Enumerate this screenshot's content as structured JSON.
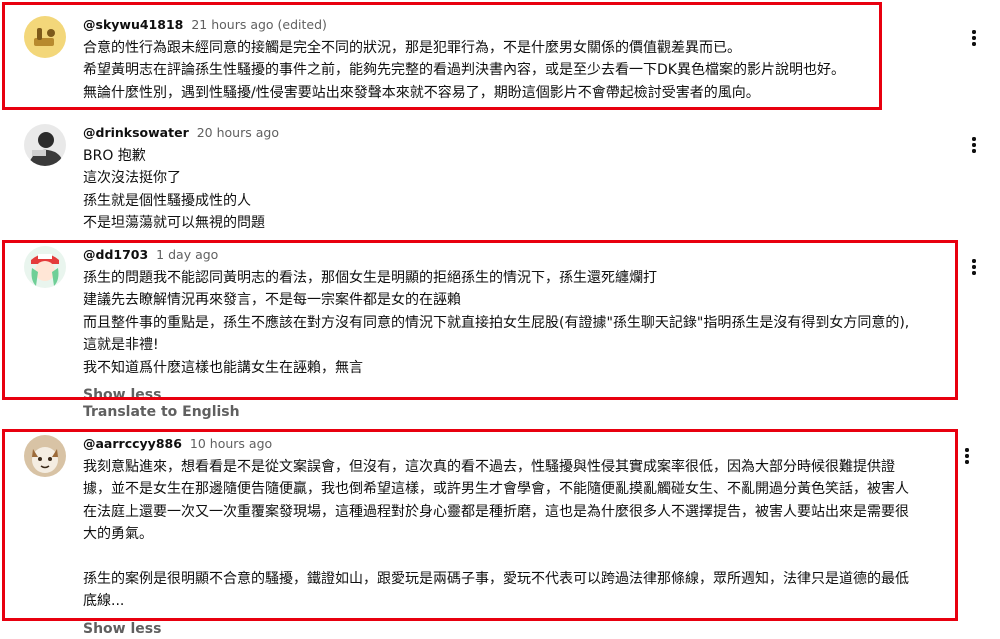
{
  "comments": [
    {
      "author": "@skywu41818",
      "time": "21 hours ago (edited)",
      "lines": [
        "合意的性行為跟未經同意的接觸是完全不同的狀況，那是犯罪行為，不是什麼男女關係的價值觀差異而已。",
        "希望黃明志在評論孫生性騷擾的事件之前，能夠先完整的看過判決書內容，或是至少去看一下DK異色檔案的影片說明也好。",
        "無論什麼性別，遇到性騷擾/性侵害要站出來發聲本來就不容易了，期盼這個影片不會帶起檢討受害者的風向。"
      ],
      "highlight_color": "#e8000f"
    },
    {
      "author": "@drinksowater",
      "time": "20 hours ago",
      "lines": [
        "BRO 抱歉",
        "這次沒法挺你了",
        "孫生就是個性騷擾成性的人",
        "不是坦蕩蕩就可以無視的問題"
      ]
    },
    {
      "author": "@dd1703",
      "time": "1 day ago",
      "lines": [
        "孫生的問題我不能認同黃明志的看法，那個女生是明顯的拒絕孫生的情況下，孫生還死纏爛打",
        "建議先去瞭解情況再來發言，不是每一宗案件都是女的在誣賴",
        "而且整件事的重點是，孫生不應該在對方沒有同意的情況下就直接拍女生屁股(有證據\"孫生聊天記錄\"指明孫生是沒有得到女方同意的),",
        "這就是非禮!",
        "我不知道爲什麽這樣也能講女生在誣賴，無言"
      ],
      "expand_label": "Show less",
      "translate_label": "Translate to English"
    },
    {
      "author": "@aarrccyy886",
      "time": "10 hours ago",
      "lines": [
        "我刻意點進來，想看看是不是從文案誤會，但沒有，這次真的看不過去，性騷擾與性侵其實成案率很低，因為大部分時候很難提供證",
        "據，並不是女生在那邊隨便告隨便贏，我也倒希望這樣，或許男生才會學會，不能隨便亂摸亂觸碰女生、不亂開過分黃色笑話，被害人",
        "在法庭上還要一次又一次重覆案發現場，這種過程對於身心靈都是種折磨，這也是為什麼很多人不選擇提告，被害人要站出來是需要很",
        "大的勇氣。",
        "",
        "孫生的案例是很明顯不合意的騷擾，鐵證如山，跟愛玩是兩碼子事，愛玩不代表可以跨過法律那條線，眾所週知，法律只是道德的最低",
        "底線..."
      ],
      "expand_label": "Show less"
    }
  ]
}
